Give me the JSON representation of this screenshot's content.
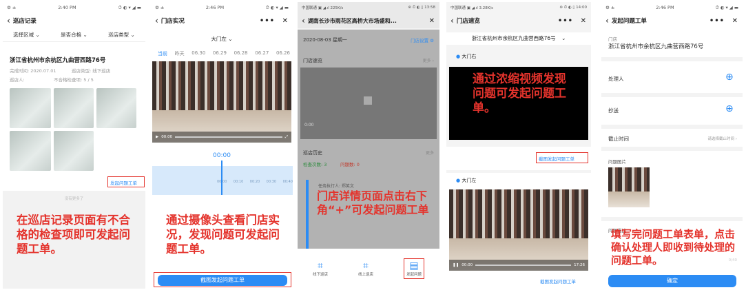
{
  "phone1": {
    "status_left": "⚙ ±",
    "status_time": "2:40 PM",
    "status_right": "⏱ ◐ ▾ ◢ ▬",
    "title": "巡店记录",
    "filters": [
      "选择区域",
      "是否合格",
      "巡店类型"
    ],
    "address": "浙江省杭州市余杭区九曲营西路76号",
    "complete_time": "完成时间: 2020.07.01",
    "shop_type": "巡店类型: 线下巡店",
    "inspector": "巡店人:",
    "unqualified": "不合格检查项: 5 / 5",
    "action": "发起问题工单",
    "no_more": "没有更多了",
    "callout": "在巡店记录页面有不合格的检查项即可发起问题工单。"
  },
  "phone2": {
    "status_left": "⚙ ±",
    "status_time": "2:46 PM",
    "status_right": "⏱ ◐ ▾ ◢ ▬",
    "title": "门店实况",
    "camera": "大门左",
    "dates": [
      "当前",
      "昨天",
      "06.30",
      "06.29",
      "06.28",
      "06.27",
      "06.26"
    ],
    "video_time": "00:00",
    "timeline_time": "00:00",
    "timeline_ticks": [
      "00:00",
      "00:10",
      "00:20",
      "00:30",
      "00:40"
    ],
    "callout": "通过摄像头查看门店实况，发现问题可发起问题工单。",
    "button": "截图发起问题工单"
  },
  "phone3": {
    "status_left": "中国联通 ▣ ◢.ıl 225K/s",
    "status_right": "⊛ ⏱ ◐ ▯ 13:58",
    "title": "湖南长沙市雨花区高桥大市场盛和...",
    "date": "2020-08-03 星期一",
    "setting": "门店设置",
    "speed_title": "门店速览",
    "more1": "更多",
    "video_time": "0:00",
    "history_title": "巡店历史",
    "more2": "更多",
    "check_count": "检查次数: 3",
    "problem_count": "问题数: 0",
    "task_executor": "任务执行人: 郑笑文",
    "callout": "门店详情页面点击右下角“+”可发起问题工单",
    "tabs": [
      "线下巡店",
      "线上巡店",
      "发起问题"
    ]
  },
  "phone4": {
    "status_left": "中国联通 ▣ ◢.ıl 3.28K/s",
    "status_right": "⊛ ⏱ ◐ ▯ 14:00",
    "title": "门店速览",
    "address": "浙江省杭州市余杭区九曲营西路76号",
    "cam1": "大门右",
    "callout": "通过浓缩视频发现问题可发起问题工单。",
    "link1": "截图发起问题工单",
    "cam2": "大门左",
    "video_time": "00:00",
    "video_end": "17:26",
    "link2": "截图发起问题工单"
  },
  "phone5": {
    "status_left": "⚙ ±",
    "status_time": "2:46 PM",
    "status_right": "⏱ ◐ ▾ ◢ ▬",
    "title": "发起问题工单",
    "store_label": "门店",
    "store_value": "浙江省杭州市余杭区九曲营西路76号",
    "handler": "处理人",
    "cc": "抄送",
    "deadline": "截止时间",
    "deadline_placeholder": "请选择截止时间",
    "images": "问题图片",
    "desc": "问题描述",
    "counter": "0/40",
    "callout": "填写完问题工单表单，点击确认处理人即收到待处理的问题工单。",
    "confirm": "确定"
  },
  "colors": {
    "accent": "#2c8cf4",
    "callout": "#e4332c"
  }
}
